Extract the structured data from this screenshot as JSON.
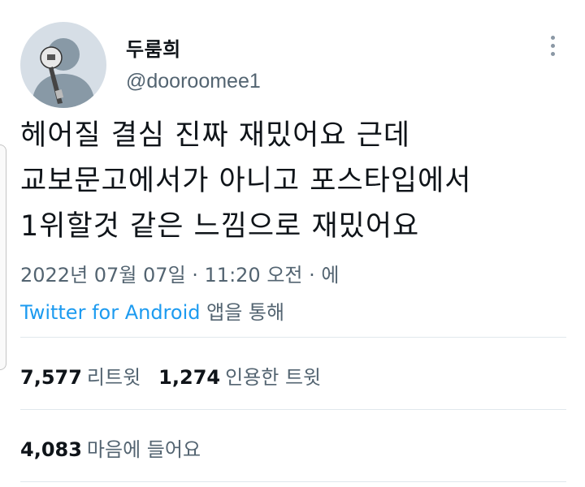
{
  "user": {
    "display_name": "두룸희",
    "handle": "@dooroomee1",
    "avatar_icon": "default-avatar-icon"
  },
  "tweet": {
    "lines": [
      "헤어질 결심 진짜 재밌어요 근데",
      "교보문고에서가 아니고 포스타입에서",
      "1위할것 같은 느낌으로 재밌어요"
    ]
  },
  "meta": {
    "date": "2022년 07월 07일 · 11:20 오전 · 에",
    "source": "Twitter for Android",
    "source_suffix": " 앱을 통해"
  },
  "stats": {
    "retweets": "7,577",
    "retweets_label": "리트윗",
    "quotes": "1,274",
    "quotes_label": "인용한 트윗",
    "likes": "4,083",
    "likes_label": "마음에 들어요"
  },
  "colors": {
    "accent": "#1d9bf0",
    "secondary_text": "#536471",
    "divider": "#e1e8ed"
  },
  "more_icon": "more-vertical-icon"
}
